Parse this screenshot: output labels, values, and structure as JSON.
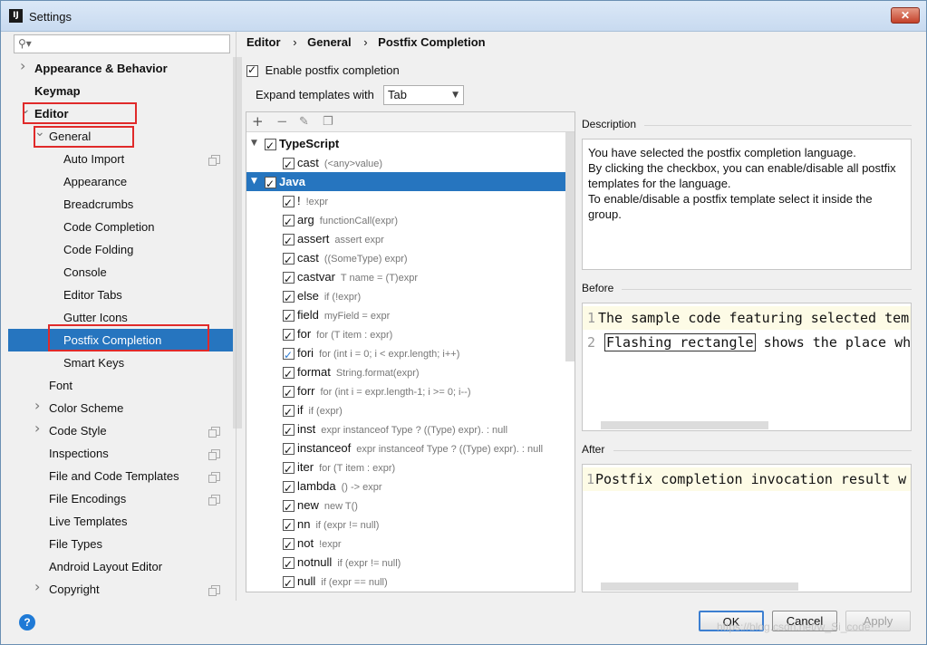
{
  "window": {
    "title": "Settings",
    "app_icon": "IJ"
  },
  "search": {
    "placeholder": ""
  },
  "sidebar": {
    "items": [
      {
        "label": "Appearance & Behavior",
        "bold": true,
        "arrow": "right"
      },
      {
        "label": "Keymap",
        "bold": true
      },
      {
        "label": "Editor",
        "bold": true,
        "arrow": "down"
      },
      {
        "label": "General",
        "arrow": "down"
      },
      {
        "label": "Auto Import",
        "copy": true
      },
      {
        "label": "Appearance"
      },
      {
        "label": "Breadcrumbs"
      },
      {
        "label": "Code Completion"
      },
      {
        "label": "Code Folding"
      },
      {
        "label": "Console"
      },
      {
        "label": "Editor Tabs"
      },
      {
        "label": "Gutter Icons"
      },
      {
        "label": "Postfix Completion",
        "selected": true
      },
      {
        "label": "Smart Keys"
      },
      {
        "label": "Font"
      },
      {
        "label": "Color Scheme",
        "arrow": "right"
      },
      {
        "label": "Code Style",
        "arrow": "right",
        "copy": true
      },
      {
        "label": "Inspections",
        "copy": true
      },
      {
        "label": "File and Code Templates",
        "copy": true
      },
      {
        "label": "File Encodings",
        "copy": true
      },
      {
        "label": "Live Templates"
      },
      {
        "label": "File Types"
      },
      {
        "label": "Android Layout Editor"
      },
      {
        "label": "Copyright",
        "arrow": "right",
        "copy": true
      }
    ]
  },
  "breadcrumb": {
    "items": [
      "Editor",
      "General",
      "Postfix Completion"
    ],
    "separator": "›"
  },
  "enable_postfix": {
    "label": "Enable postfix completion",
    "checked": true
  },
  "expand": {
    "label": "Expand templates with",
    "value": "Tab"
  },
  "templates": [
    {
      "name": "TypeScript",
      "example": "",
      "group": true,
      "arrow": "▼"
    },
    {
      "name": "cast",
      "example": "(<any>value)"
    },
    {
      "name": "Java",
      "example": "",
      "group": true,
      "arrow": "▼",
      "selected": true
    },
    {
      "name": "!",
      "example": "!expr"
    },
    {
      "name": "arg",
      "example": "functionCall(expr)"
    },
    {
      "name": "assert",
      "example": "assert expr"
    },
    {
      "name": "cast",
      "example": "((SomeType) expr)"
    },
    {
      "name": "castvar",
      "example": "T name = (T)expr"
    },
    {
      "name": "else",
      "example": "if (!expr)"
    },
    {
      "name": "field",
      "example": "myField = expr"
    },
    {
      "name": "for",
      "example": "for (T item : expr)"
    },
    {
      "name": "fori",
      "example": "for (int i = 0; i < expr.length; i++)",
      "blue": true
    },
    {
      "name": "format",
      "example": "String.format(expr)"
    },
    {
      "name": "forr",
      "example": "for (int i = expr.length-1; i >= 0; i--)"
    },
    {
      "name": "if",
      "example": "if (expr)"
    },
    {
      "name": "inst",
      "example": "expr instanceof Type ? ((Type) expr). : null"
    },
    {
      "name": "instanceof",
      "example": "expr instanceof Type ? ((Type) expr). : null"
    },
    {
      "name": "iter",
      "example": "for (T item : expr)"
    },
    {
      "name": "lambda",
      "example": "() -> expr"
    },
    {
      "name": "new",
      "example": "new T()"
    },
    {
      "name": "nn",
      "example": "if (expr != null)"
    },
    {
      "name": "not",
      "example": "!expr"
    },
    {
      "name": "notnull",
      "example": "if (expr != null)"
    },
    {
      "name": "null",
      "example": "if (expr == null)"
    }
  ],
  "description": {
    "title": "Description",
    "lines": [
      "You have selected the postfix completion language.",
      "By clicking the checkbox, you can enable/disable all postfix",
      "templates for the language.",
      "To enable/disable a postfix template select it inside the",
      "group."
    ]
  },
  "before": {
    "title": "Before",
    "line1_num": "1",
    "line1": "The sample code featuring selected tem",
    "line2_num": "2",
    "line2_flash": "Flashing rectangle",
    "line2_rest": " shows the place wh"
  },
  "after": {
    "title": "After",
    "line1_num": "1",
    "line1": "Postfix completion invocation result w"
  },
  "buttons": {
    "ok": "OK",
    "cancel": "Cancel",
    "apply": "Apply",
    "help": "?"
  },
  "watermark": "https://blog.csdn.net/w_Si_code",
  "colors": {
    "selection": "#2675bf",
    "highlight_box": "#e02a2a",
    "ok_border": "#3c7fd1"
  }
}
